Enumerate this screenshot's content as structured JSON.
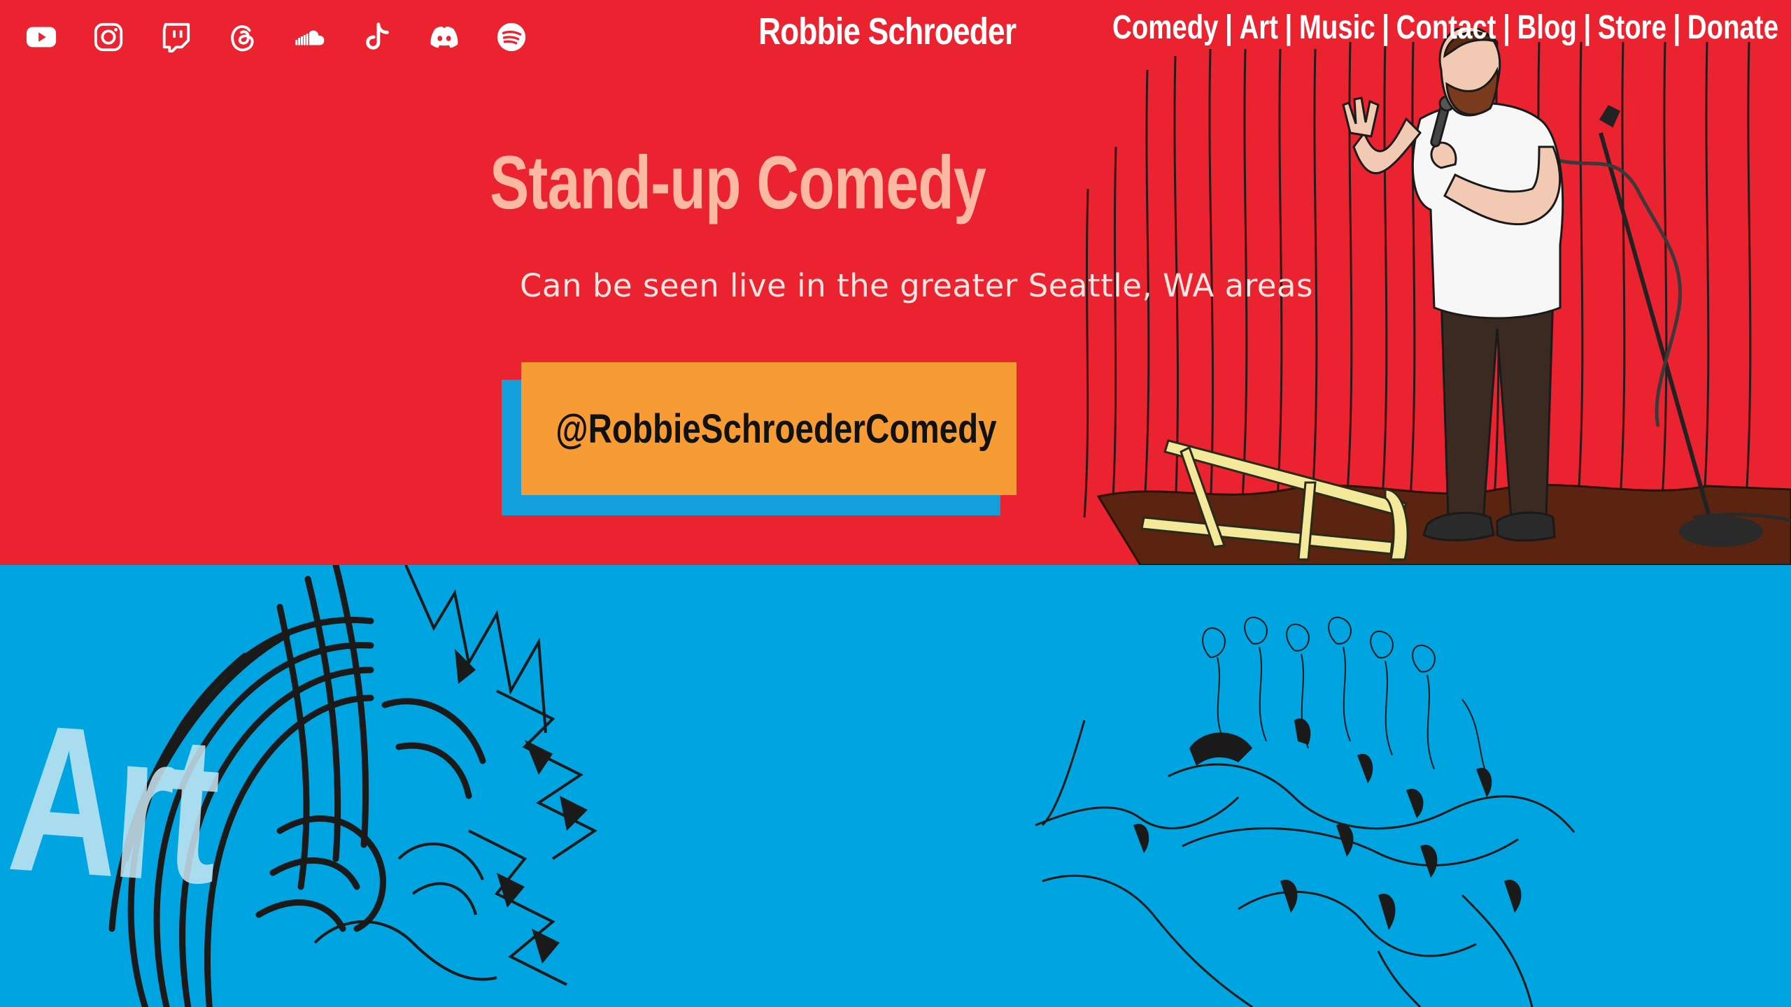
{
  "header": {
    "site_title": "Robbie Schroeder",
    "social_icons": [
      "youtube-icon",
      "instagram-icon",
      "twitch-icon",
      "threads-icon",
      "soundcloud-icon",
      "tiktok-icon",
      "discord-icon",
      "spotify-icon"
    ],
    "nav": [
      "Comedy",
      "Art",
      "Music",
      "Contact",
      "Blog",
      "Store",
      "Donate"
    ],
    "nav_separator": "|"
  },
  "hero": {
    "heading": "Stand-up Comedy",
    "subtitle": "Can be seen live in the greater Seattle, WA areas",
    "cta_label": "@RobbieSchroederComedy"
  },
  "art": {
    "heading": "Art"
  },
  "colors": {
    "hero_bg": "#eb2230",
    "art_bg": "#00a4e0",
    "heading": "#fbb8a3",
    "cta_bg": "#f79c34",
    "cta_shadow": "#129fdc"
  }
}
